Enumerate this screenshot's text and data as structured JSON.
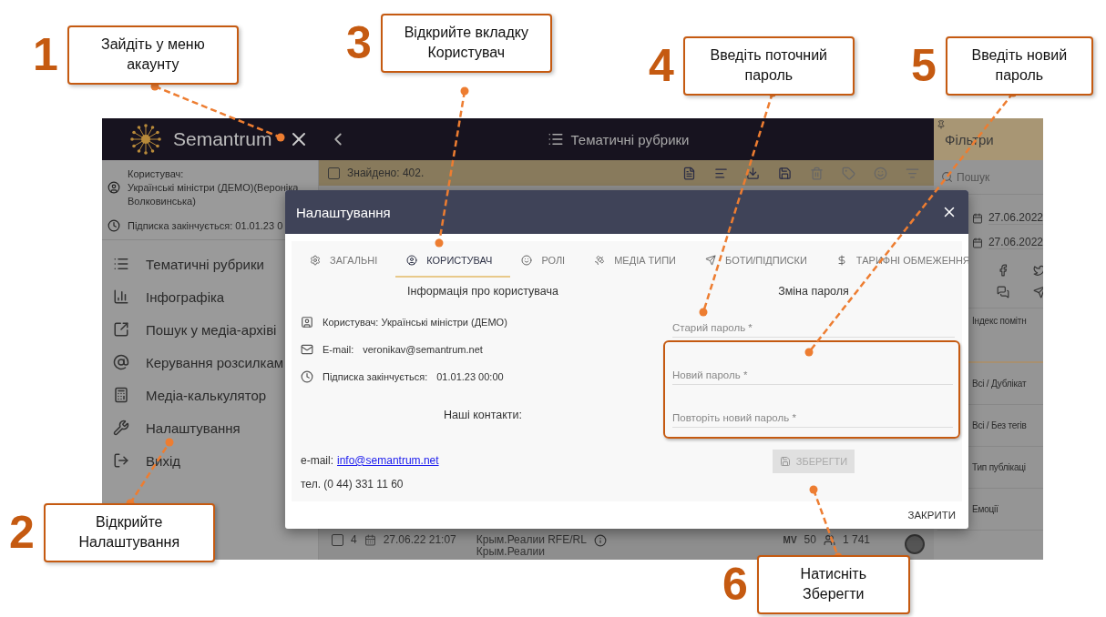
{
  "callouts": [
    {
      "number": "1",
      "text": "Зайдіть у меню акаунту"
    },
    {
      "number": "2",
      "text": "Відкрийте Налаштування"
    },
    {
      "number": "3",
      "text": "Відкрийте вкладку Користувач"
    },
    {
      "number": "4",
      "text": "Введіть поточний пароль"
    },
    {
      "number": "5",
      "text": "Введіть новий пароль"
    },
    {
      "number": "6",
      "text": "Натисніть Зберегти"
    }
  ],
  "app": {
    "logo": "Semantrum",
    "header_title": "Тематичні рубрики",
    "sidebar": {
      "user_label": "Користувач:",
      "user_name": "Українські міністри (ДЕМО)(Вероніка Волковинська)",
      "subscription": "Підписка закінчується: 01.01.23 0",
      "items": [
        {
          "kind": "list",
          "label": "Тематичні рубрики"
        },
        {
          "kind": "chart",
          "label": "Інфографіка"
        },
        {
          "kind": "external",
          "label": "Пошук у медіа-архіві"
        },
        {
          "kind": "at",
          "label": "Керування розсилкам"
        },
        {
          "kind": "calculator",
          "label": "Медіа-калькулятор"
        },
        {
          "kind": "wrench",
          "label": "Налаштування"
        },
        {
          "kind": "logout",
          "label": "Вихід"
        }
      ]
    },
    "toolbar": {
      "checked": false,
      "found": "Знайдено: 402."
    },
    "row": {
      "checked": false,
      "index": "4",
      "date": "27.06.22 21:07",
      "source": "Крым.Реалии RFE/RL",
      "source_sub": "Крым.Реалии",
      "mv": "MV",
      "mv_value": "50",
      "audience": "1 741"
    },
    "filters": {
      "title": "Фільтри",
      "search_placeholder": "Пошук",
      "dates": [
        "27.06.2022",
        "27.06.2022"
      ],
      "sections": [
        "Індекс помітн",
        "Всі / Дублікат",
        "Всі / Без тегів",
        "Тип публікаці",
        "Емоції"
      ]
    }
  },
  "dialog": {
    "title": "Налаштування",
    "tabs": [
      {
        "kind": "gear",
        "label": "ЗАГАЛЬНІ",
        "selected": false
      },
      {
        "kind": "user",
        "label": "КОРИСТУВАЧ",
        "selected": true
      },
      {
        "kind": "roles",
        "label": "РОЛІ",
        "selected": false
      },
      {
        "kind": "satellite",
        "label": "МЕДІА ТИПИ",
        "selected": false
      },
      {
        "kind": "send",
        "label": "БОТИ/ПІДПИСКИ",
        "selected": false
      },
      {
        "kind": "dollar",
        "label": "ТАРИФНІ ОБМЕЖЕННЯ",
        "selected": false
      }
    ],
    "info_title": "Інформація про користувача",
    "user_line": "Користувач: Українські міністри (ДЕМО)",
    "email_label": "E-mail:",
    "email": "veronikav@semantrum.net",
    "subscription_label": "Підписка закінчується:",
    "subscription": "01.01.23 00:00",
    "contacts_title": "Наші контакти:",
    "contact_email_label": "e-mail:",
    "contact_email": "info@semantrum.net",
    "phone": "тел. (0 44) 331 11 60",
    "password_title": "Зміна пароля",
    "fields": [
      {
        "placeholder": "Старий пароль *"
      },
      {
        "placeholder": "Новий пароль *"
      },
      {
        "placeholder": "Повторіть новий пароль *"
      }
    ],
    "new_password_highlighted": true,
    "save": {
      "label": "ЗБЕРЕГТИ",
      "disabled": true
    },
    "close_label": "ЗАКРИТИ"
  }
}
